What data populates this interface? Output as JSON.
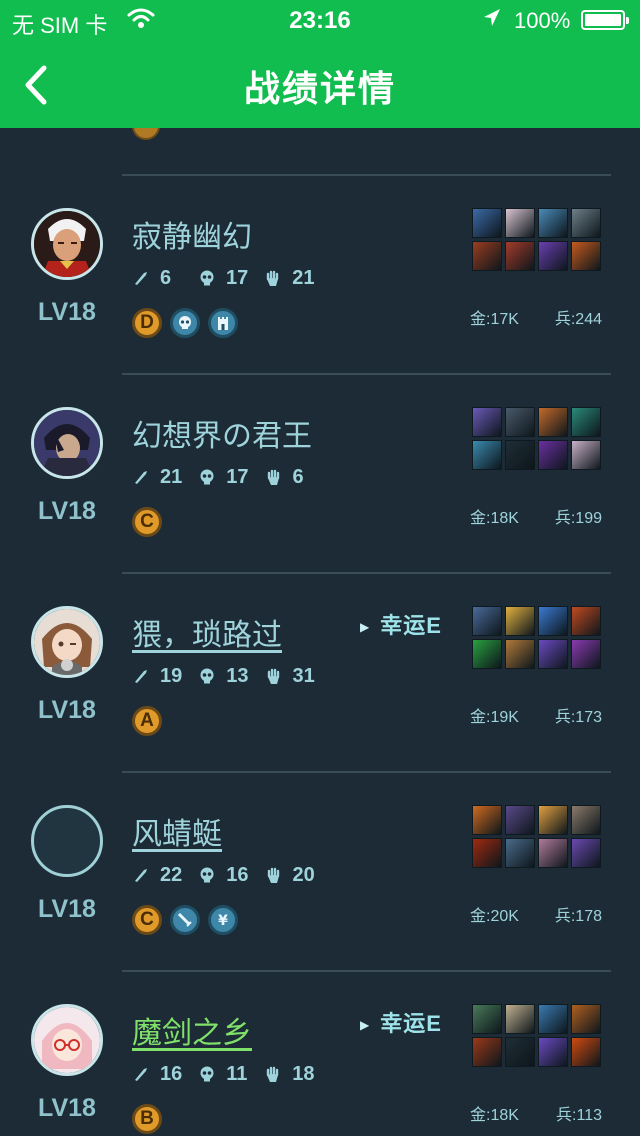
{
  "status_bar": {
    "carrier": "无 SIM 卡",
    "time": "23:16",
    "battery": "100%"
  },
  "header": {
    "title": "战绩详情",
    "back_icon": "chevron-left-icon"
  },
  "colors": {
    "accent": "#11bd4e",
    "background": "#1c2b35",
    "text": "#9fd3dc",
    "grade": "#e09a2a",
    "name_highlight": "#7fe06a"
  },
  "players": [
    {
      "name": "寂静幽幻",
      "level": "LV18",
      "kills": "6",
      "deaths": "17",
      "assists": "21",
      "grade": "D",
      "spells": [
        "skull-icon",
        "tower-icon"
      ],
      "lucky": "",
      "gold": "金:17K",
      "minions": "兵:244",
      "avatar": "red-hero-avatar",
      "items": [
        "#3c6aa8",
        "#d8c4d0",
        "#4a8ab8",
        "#6d7f8a",
        "#9a3d20",
        "#a33b2a",
        "#6a3fb0",
        "#c45a1e"
      ]
    },
    {
      "name": "幻想界の君王",
      "level": "LV18",
      "kills": "21",
      "deaths": "17",
      "assists": "6",
      "grade": "C",
      "spells": [],
      "lucky": "",
      "gold": "金:18K",
      "minions": "兵:199",
      "avatar": "dark-hero-avatar",
      "items": [
        "#6b5ab8",
        "#4a5a6a",
        "#c46a2a",
        "#2a8a7a",
        "#3a8ab0",
        "#1f2e36",
        "#6a2fa0",
        "#c8b0c8"
      ]
    },
    {
      "name": "猥，琐路过",
      "level": "LV18",
      "kills": "19",
      "deaths": "13",
      "assists": "31",
      "grade": "A",
      "spells": [],
      "lucky": "幸运E",
      "gold": "金:19K",
      "minions": "兵:173",
      "avatar": "anime-girl-avatar",
      "items": [
        "#4a6a9a",
        "#e0b040",
        "#3a7ad0",
        "#c04a20",
        "#2aa040",
        "#b07a3a",
        "#6a4ac0",
        "#8a3ab0"
      ]
    },
    {
      "name": "风蜻蜓",
      "level": "LV18",
      "kills": "22",
      "deaths": "16",
      "assists": "20",
      "grade": "C",
      "spells": [
        "sword-icon",
        "yen-icon"
      ],
      "lucky": "",
      "gold": "金:20K",
      "minions": "兵:178",
      "avatar": "",
      "items": [
        "#d06a20",
        "#5a4a8a",
        "#e0a040",
        "#8a7a6a",
        "#a02a10",
        "#4a6a8a",
        "#b07a9a",
        "#6a4ab0"
      ]
    },
    {
      "name": "魔剑之乡",
      "level": "LV18",
      "kills": "16",
      "deaths": "11",
      "assists": "18",
      "grade": "B",
      "spells": [],
      "lucky": "幸运E",
      "gold": "金:18K",
      "minions": "兵:113",
      "avatar": "pink-hair-avatar",
      "items": [
        "#4a7a5a",
        "#c0b090",
        "#3a7ab0",
        "#b06020",
        "#9a3a1a",
        "#1f2e36",
        "#6a4ac0",
        "#d04a10"
      ]
    }
  ]
}
